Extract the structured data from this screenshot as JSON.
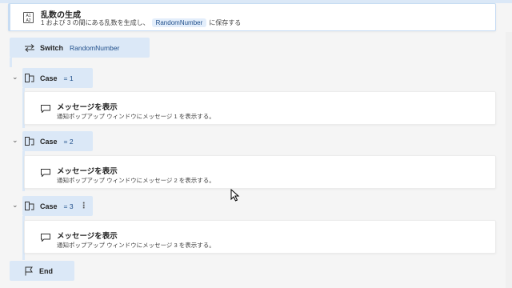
{
  "random_action": {
    "title": "乱数の生成",
    "sub_prefix": "1 および 3 の間にある乱数を生成し、",
    "variable": "RandomNumber",
    "sub_suffix": "に保存する",
    "icon": "random-number-icon"
  },
  "switch_block": {
    "keyword": "Switch",
    "value": "RandomNumber",
    "icon": "switch-arrows-icon"
  },
  "cases": [
    {
      "keyword": "Case",
      "value": "= 1",
      "message": {
        "title": "メッセージを表示",
        "subtitle": "通知ポップアップ ウィンドウにメッセージ 1 を表示する。"
      }
    },
    {
      "keyword": "Case",
      "value": "= 2",
      "message": {
        "title": "メッセージを表示",
        "subtitle": "通知ポップアップ ウィンドウにメッセージ 2 を表示する。"
      }
    },
    {
      "keyword": "Case",
      "value": "= 3",
      "message": {
        "title": "メッセージを表示",
        "subtitle": "通知ポップアップ ウィンドウにメッセージ 3 を表示する。"
      }
    }
  ],
  "end_block": {
    "keyword": "End",
    "icon": "flag-icon"
  },
  "colors": {
    "accent_bg": "#dbe8f7",
    "chip_text": "#1f4e8a"
  }
}
